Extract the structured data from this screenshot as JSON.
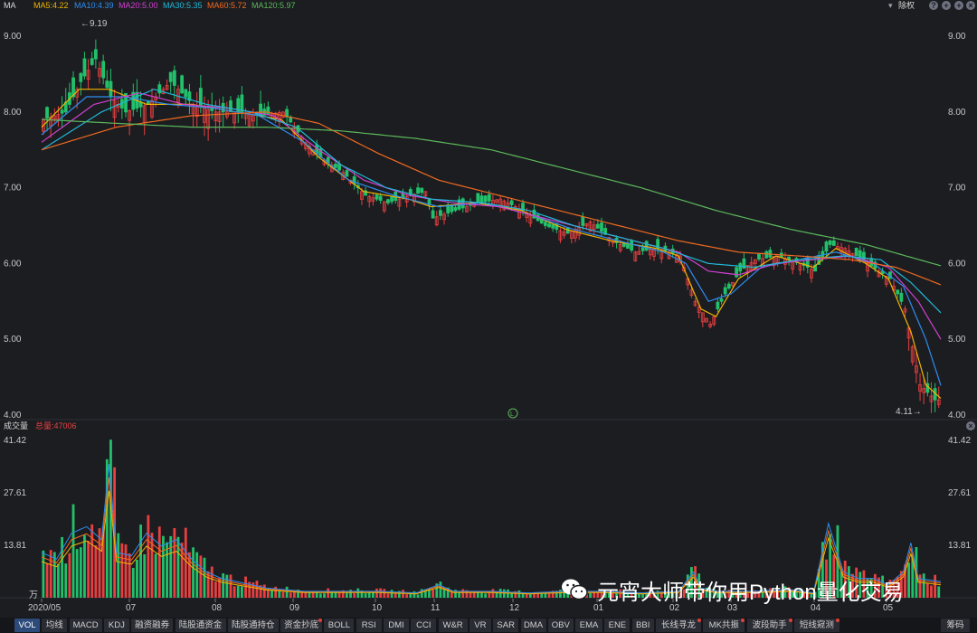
{
  "header": {
    "indicator": "MA",
    "ma_labels": [
      {
        "text": "MA5:4.22",
        "color": "#f0b400"
      },
      {
        "text": "MA10:4.39",
        "color": "#2e8cf0"
      },
      {
        "text": "MA20:5.00",
        "color": "#d040d0"
      },
      {
        "text": "MA30:5.35",
        "color": "#20b8d8"
      },
      {
        "text": "MA60:5.72",
        "color": "#f06a20"
      },
      {
        "text": "MA120:5.97",
        "color": "#5cb85c"
      }
    ],
    "adjust": "除权",
    "controls": [
      "?",
      "+",
      "+",
      "×"
    ]
  },
  "volume_header": {
    "title": "成交量",
    "total": "总量:47006"
  },
  "annotations": {
    "high": "←9.19",
    "low": "4.11→",
    "marker": "L",
    "vol_unit": "万"
  },
  "watermark": "元宵大师带你用Python量化交易",
  "tabs": [
    "VOL",
    "均线",
    "MACD",
    "KDJ",
    "融资融券",
    "陆股通资金",
    "陆股通持仓",
    "资金抄底",
    "BOLL",
    "RSI",
    "DMI",
    "CCI",
    "W&R",
    "VR",
    "SAR",
    "DMA",
    "OBV",
    "EMA",
    "ENE",
    "BBI",
    "长线寻龙",
    "MK共振",
    "波段助手",
    "短线窥测",
    "筹码"
  ],
  "active_tab": "VOL",
  "colors": {
    "up": "#e84040",
    "down": "#22c06a",
    "bg": "#1c1d21"
  },
  "chart_data": [
    {
      "type": "candlestick",
      "ylim": [
        4.0,
        9.3
      ],
      "yticks": [
        "9.00",
        "8.00",
        "7.00",
        "6.00",
        "5.00",
        "4.00"
      ],
      "xticks": [
        "2020/05",
        "07",
        "08",
        "09",
        "10",
        "11",
        "12",
        "01",
        "02",
        "03",
        "04",
        "05"
      ],
      "high_label": "9.19",
      "low_label": "4.11",
      "close_path": [
        [
          0,
          7.9
        ],
        [
          6,
          8.0
        ],
        [
          10,
          8.4
        ],
        [
          14,
          8.7
        ],
        [
          18,
          8.2
        ],
        [
          22,
          8.0
        ],
        [
          28,
          8.1
        ],
        [
          34,
          8.4
        ],
        [
          40,
          8.1
        ],
        [
          46,
          8.0
        ],
        [
          52,
          8.0
        ],
        [
          58,
          7.95
        ],
        [
          64,
          8.0
        ],
        [
          70,
          7.6
        ],
        [
          74,
          7.4
        ],
        [
          80,
          7.2
        ],
        [
          86,
          6.9
        ],
        [
          92,
          6.8
        ],
        [
          98,
          6.9
        ],
        [
          102,
          6.95
        ],
        [
          104,
          6.6
        ],
        [
          110,
          6.7
        ],
        [
          116,
          6.8
        ],
        [
          122,
          6.85
        ],
        [
          128,
          6.7
        ],
        [
          134,
          6.5
        ],
        [
          140,
          6.4
        ],
        [
          146,
          6.55
        ],
        [
          152,
          6.3
        ],
        [
          158,
          6.15
        ],
        [
          164,
          6.2
        ],
        [
          170,
          6.1
        ],
        [
          174,
          5.5
        ],
        [
          178,
          5.2
        ],
        [
          182,
          5.6
        ],
        [
          186,
          5.9
        ],
        [
          190,
          6.05
        ],
        [
          196,
          6.1
        ],
        [
          202,
          6.0
        ],
        [
          206,
          5.9
        ],
        [
          210,
          6.25
        ],
        [
          214,
          6.2
        ],
        [
          220,
          6.0
        ],
        [
          226,
          5.8
        ],
        [
          230,
          5.4
        ],
        [
          232,
          4.9
        ],
        [
          234,
          4.4
        ],
        [
          238,
          4.2
        ]
      ],
      "series": [
        {
          "name": "MA5",
          "path": [
            [
              0,
              7.8
            ],
            [
              10,
              8.3
            ],
            [
              18,
              8.3
            ],
            [
              28,
              8.1
            ],
            [
              40,
              8.1
            ],
            [
              52,
              8.0
            ],
            [
              64,
              7.9
            ],
            [
              74,
              7.4
            ],
            [
              86,
              6.95
            ],
            [
              98,
              6.85
            ],
            [
              104,
              6.75
            ],
            [
              116,
              6.8
            ],
            [
              128,
              6.7
            ],
            [
              140,
              6.45
            ],
            [
              152,
              6.3
            ],
            [
              164,
              6.2
            ],
            [
              170,
              6.1
            ],
            [
              176,
              5.4
            ],
            [
              180,
              5.3
            ],
            [
              186,
              5.8
            ],
            [
              196,
              6.1
            ],
            [
              206,
              5.95
            ],
            [
              212,
              6.2
            ],
            [
              220,
              6.0
            ],
            [
              226,
              5.8
            ],
            [
              232,
              5.1
            ],
            [
              236,
              4.4
            ],
            [
              240,
              4.22
            ]
          ]
        },
        {
          "name": "MA10",
          "path": [
            [
              0,
              7.7
            ],
            [
              12,
              8.2
            ],
            [
              22,
              8.2
            ],
            [
              34,
              8.1
            ],
            [
              46,
              8.05
            ],
            [
              58,
              7.95
            ],
            [
              70,
              7.6
            ],
            [
              82,
              7.1
            ],
            [
              94,
              6.9
            ],
            [
              106,
              6.75
            ],
            [
              118,
              6.8
            ],
            [
              130,
              6.65
            ],
            [
              142,
              6.45
            ],
            [
              154,
              6.3
            ],
            [
              166,
              6.15
            ],
            [
              172,
              6.0
            ],
            [
              178,
              5.5
            ],
            [
              184,
              5.6
            ],
            [
              192,
              5.95
            ],
            [
              202,
              6.05
            ],
            [
              212,
              6.15
            ],
            [
              222,
              6.0
            ],
            [
              230,
              5.7
            ],
            [
              236,
              5.0
            ],
            [
              240,
              4.39
            ]
          ]
        },
        {
          "name": "MA20",
          "path": [
            [
              0,
              7.6
            ],
            [
              14,
              8.1
            ],
            [
              26,
              8.25
            ],
            [
              38,
              8.1
            ],
            [
              50,
              8.05
            ],
            [
              62,
              7.95
            ],
            [
              74,
              7.5
            ],
            [
              86,
              7.1
            ],
            [
              98,
              6.9
            ],
            [
              110,
              6.8
            ],
            [
              122,
              6.75
            ],
            [
              134,
              6.6
            ],
            [
              146,
              6.45
            ],
            [
              158,
              6.3
            ],
            [
              170,
              6.15
            ],
            [
              178,
              5.9
            ],
            [
              186,
              5.85
            ],
            [
              196,
              6.0
            ],
            [
              206,
              6.05
            ],
            [
              216,
              6.1
            ],
            [
              226,
              5.95
            ],
            [
              234,
              5.5
            ],
            [
              240,
              5.0
            ]
          ]
        },
        {
          "name": "MA30",
          "path": [
            [
              0,
              7.5
            ],
            [
              16,
              8.0
            ],
            [
              30,
              8.3
            ],
            [
              44,
              8.1
            ],
            [
              56,
              8.0
            ],
            [
              68,
              7.8
            ],
            [
              80,
              7.3
            ],
            [
              92,
              7.0
            ],
            [
              104,
              6.85
            ],
            [
              118,
              6.8
            ],
            [
              130,
              6.7
            ],
            [
              142,
              6.5
            ],
            [
              154,
              6.35
            ],
            [
              166,
              6.2
            ],
            [
              178,
              6.0
            ],
            [
              190,
              5.95
            ],
            [
              202,
              6.05
            ],
            [
              214,
              6.1
            ],
            [
              224,
              6.05
            ],
            [
              232,
              5.75
            ],
            [
              240,
              5.35
            ]
          ]
        },
        {
          "name": "MA60",
          "path": [
            [
              0,
              7.5
            ],
            [
              20,
              7.8
            ],
            [
              40,
              7.95
            ],
            [
              60,
              8.0
            ],
            [
              74,
              7.85
            ],
            [
              90,
              7.45
            ],
            [
              106,
              7.1
            ],
            [
              122,
              6.9
            ],
            [
              138,
              6.7
            ],
            [
              154,
              6.5
            ],
            [
              170,
              6.3
            ],
            [
              186,
              6.15
            ],
            [
              202,
              6.1
            ],
            [
              216,
              6.05
            ],
            [
              228,
              5.95
            ],
            [
              240,
              5.72
            ]
          ]
        },
        {
          "name": "MA120",
          "path": [
            [
              0,
              7.9
            ],
            [
              20,
              7.85
            ],
            [
              40,
              7.8
            ],
            [
              60,
              7.8
            ],
            [
              80,
              7.75
            ],
            [
              100,
              7.65
            ],
            [
              120,
              7.5
            ],
            [
              140,
              7.25
            ],
            [
              160,
              7.0
            ],
            [
              180,
              6.7
            ],
            [
              200,
              6.45
            ],
            [
              220,
              6.25
            ],
            [
              240,
              5.97
            ]
          ]
        }
      ]
    },
    {
      "type": "bar",
      "ylim": [
        0,
        41.42
      ],
      "yticks": [
        "41.42",
        "27.61",
        "13.81"
      ],
      "unit": "万",
      "total": "47006",
      "volume_path": [
        [
          0,
          14
        ],
        [
          4,
          12
        ],
        [
          8,
          20
        ],
        [
          12,
          22
        ],
        [
          16,
          18
        ],
        [
          18,
          41.4
        ],
        [
          20,
          14
        ],
        [
          24,
          13
        ],
        [
          28,
          20
        ],
        [
          32,
          16
        ],
        [
          36,
          18
        ],
        [
          40,
          12
        ],
        [
          44,
          8
        ],
        [
          48,
          6
        ],
        [
          52,
          5
        ],
        [
          56,
          4
        ],
        [
          60,
          3
        ],
        [
          70,
          2
        ],
        [
          80,
          2
        ],
        [
          90,
          2
        ],
        [
          100,
          1.5
        ],
        [
          106,
          4
        ],
        [
          110,
          2
        ],
        [
          120,
          2
        ],
        [
          130,
          1.5
        ],
        [
          140,
          2
        ],
        [
          150,
          2
        ],
        [
          160,
          1.5
        ],
        [
          170,
          2
        ],
        [
          174,
          8
        ],
        [
          176,
          3
        ],
        [
          180,
          2
        ],
        [
          190,
          2
        ],
        [
          200,
          2.5
        ],
        [
          206,
          1.5
        ],
        [
          210,
          23
        ],
        [
          214,
          8
        ],
        [
          218,
          6
        ],
        [
          222,
          6
        ],
        [
          226,
          4
        ],
        [
          230,
          8
        ],
        [
          232,
          17
        ],
        [
          234,
          6
        ],
        [
          240,
          5
        ]
      ]
    }
  ]
}
